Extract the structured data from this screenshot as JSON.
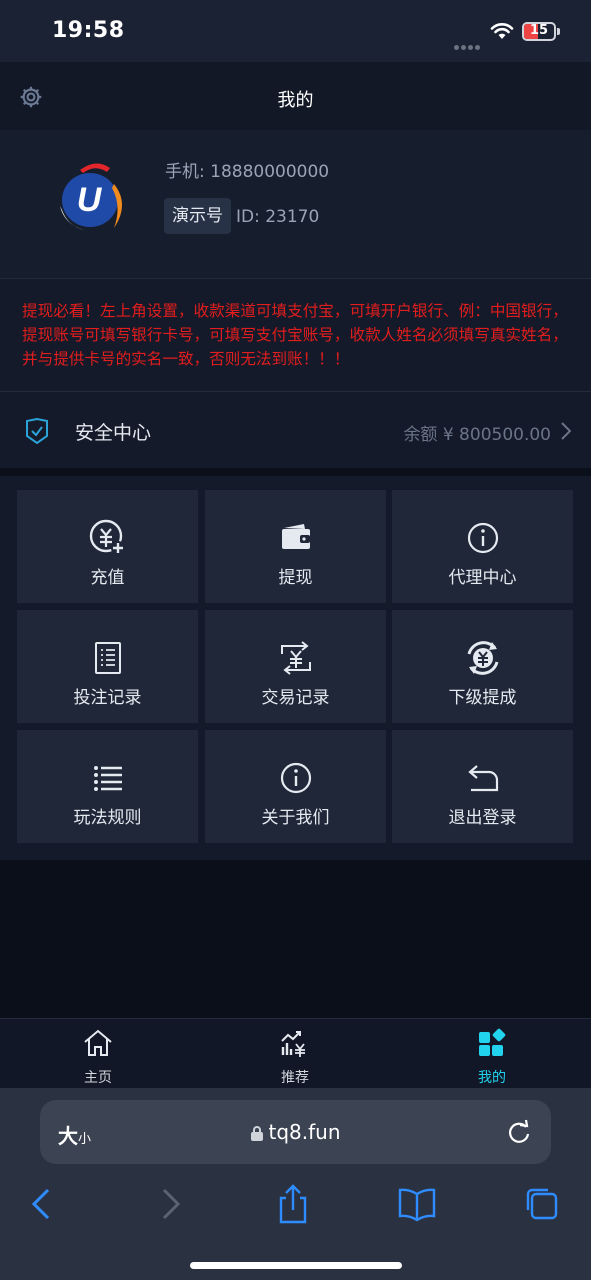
{
  "status_bar": {
    "time": "19:58",
    "battery": "15"
  },
  "nav": {
    "title": "我的"
  },
  "profile": {
    "phone": "手机: 18880000000",
    "demo_tag": "演示号",
    "user_id": "ID: 23170"
  },
  "notice": {
    "text": "提现必看！左上角设置，收款渠道可填支付宝，可填开户银行、例：中国银行，提现账号可填写银行卡号，可填写支付宝账号，收款人姓名必须填写真实姓名，并与提供卡号的实名一致，否则无法到账！！！",
    "color": "#e11d1d"
  },
  "security": {
    "label": "安全中心",
    "balance": "余额 ¥ 800500.00"
  },
  "grid": [
    {
      "label": "充值",
      "icon": "recharge-icon"
    },
    {
      "label": "提现",
      "icon": "wallet-icon"
    },
    {
      "label": "代理中心",
      "icon": "info-icon"
    },
    {
      "label": "投注记录",
      "icon": "document-list-icon"
    },
    {
      "label": "交易记录",
      "icon": "transaction-icon"
    },
    {
      "label": "下级提成",
      "icon": "commission-icon"
    },
    {
      "label": "玩法规则",
      "icon": "list-icon"
    },
    {
      "label": "关于我们",
      "icon": "info-icon"
    },
    {
      "label": "退出登录",
      "icon": "logout-icon"
    }
  ],
  "tabbar": {
    "items": [
      {
        "label": "主页",
        "icon": "home-icon"
      },
      {
        "label": "推荐",
        "icon": "chart-icon"
      },
      {
        "label": "我的",
        "icon": "dashboard-icon",
        "active": true
      }
    ],
    "active_color": "#22d3ee"
  },
  "browser": {
    "text_size_label": "大",
    "text_size_small": "小",
    "url": "tq8.fun"
  }
}
